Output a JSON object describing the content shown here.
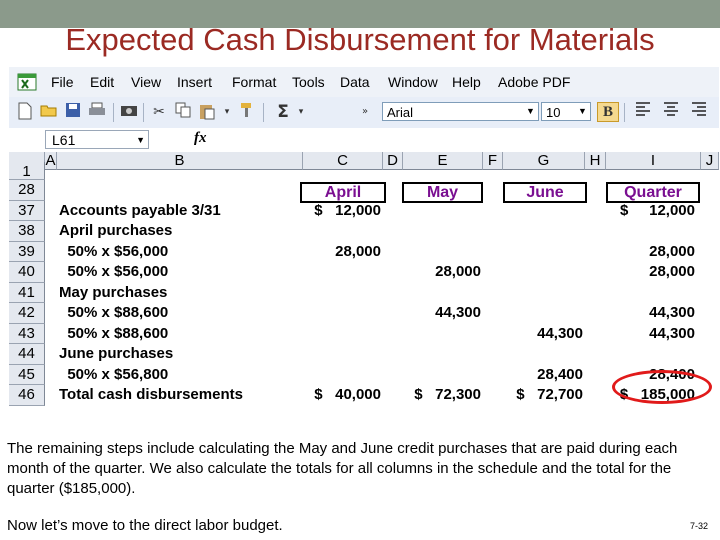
{
  "slide": {
    "title": "Expected Cash Disbursement for Materials",
    "paragraph1": "The remaining steps include calculating the May and June credit purchases that are paid during each month of the quarter. We also calculate the totals for all columns in the schedule and the total for the quarter ($185,000).",
    "paragraph2": "Now let’s move to the direct labor budget.",
    "slide_number": "7-32",
    "colors": {
      "title": "#9b2a23",
      "header_text": "#7a0f91",
      "highlight_circle": "#e11a1a",
      "top_band": "#8b9a8b"
    }
  },
  "excel": {
    "menu": [
      "File",
      "Edit",
      "View",
      "Insert",
      "Format",
      "Tools",
      "Data",
      "Window",
      "Help",
      "Adobe PDF"
    ],
    "toolbar": {
      "icons": [
        "new-icon",
        "open-icon",
        "save-icon",
        "print-icon",
        "camera-icon",
        "cut-icon",
        "copy-icon",
        "paste-icon",
        "format-painter-icon",
        "autosum-icon",
        "toolbar-options-icon",
        "bold-icon",
        "align-left-icon",
        "align-center-icon",
        "align-right-icon"
      ],
      "sigma": "Σ",
      "font_name": "Arial",
      "font_size": "10",
      "bold": "B"
    },
    "formula_bar": {
      "name_box": "L61",
      "fx": "fx",
      "value": ""
    },
    "columns": [
      "A",
      "B",
      "C",
      "D",
      "E",
      "F",
      "G",
      "H",
      "I",
      "J"
    ],
    "rows": [
      "1",
      "28",
      "37",
      "38",
      "39",
      "40",
      "41",
      "42",
      "43",
      "44",
      "45",
      "46"
    ],
    "headers": {
      "c": "April",
      "e": "May",
      "g": "June",
      "i": "Quarter"
    },
    "lines": [
      {
        "label": "Accounts payable 3/31",
        "c": "$   12,000",
        "e": "",
        "g": "",
        "i": "$     12,000"
      },
      {
        "label": "April purchases",
        "c": "",
        "e": "",
        "g": "",
        "i": ""
      },
      {
        "label": "  50% x $56,000",
        "c": "28,000",
        "e": "",
        "g": "",
        "i": "28,000"
      },
      {
        "label": "  50% x $56,000",
        "c": "",
        "e": "28,000",
        "g": "",
        "i": "28,000"
      },
      {
        "label": "May purchases",
        "c": "",
        "e": "",
        "g": "",
        "i": ""
      },
      {
        "label": "  50% x $88,600",
        "c": "",
        "e": "44,300",
        "g": "",
        "i": "44,300"
      },
      {
        "label": "  50% x $88,600",
        "c": "",
        "e": "",
        "g": "44,300",
        "i": "44,300"
      },
      {
        "label": "June purchases",
        "c": "",
        "e": "",
        "g": "",
        "i": ""
      },
      {
        "label": "  50% x $56,800",
        "c": "",
        "e": "",
        "g": "28,400",
        "i": "28,400"
      },
      {
        "label": "Total cash disbursements",
        "c": "$   40,000",
        "e": "$   72,300",
        "g": "$   72,700",
        "i": "$   185,000"
      }
    ]
  }
}
